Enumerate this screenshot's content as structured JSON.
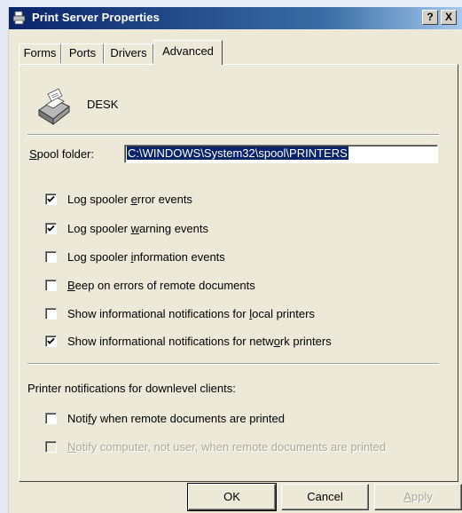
{
  "window": {
    "title": "Print Server Properties",
    "help_label": "?",
    "close_label": "X"
  },
  "tabs": [
    {
      "label": "Forms"
    },
    {
      "label": "Ports"
    },
    {
      "label": "Drivers"
    },
    {
      "label": "Advanced",
      "active": true
    }
  ],
  "server": {
    "name": "DESK"
  },
  "spool": {
    "label": "Spool folder:",
    "value": "C:\\WINDOWS\\System32\\spool\\PRINTERS"
  },
  "options": [
    {
      "label": "Log spooler error events",
      "checked": true
    },
    {
      "label": "Log spooler warning events",
      "checked": true
    },
    {
      "label": "Log spooler information events",
      "checked": false
    },
    {
      "label": "Beep on errors of remote documents",
      "checked": false
    },
    {
      "label": "Show informational notifications for local printers",
      "checked": false
    },
    {
      "label": "Show informational notifications for network printers",
      "checked": true
    }
  ],
  "downlevel": {
    "heading": "Printer notifications for downlevel clients:",
    "options": [
      {
        "label": "Notify when remote documents are printed",
        "checked": false,
        "enabled": true
      },
      {
        "label": "Notify computer, not user, when remote documents are printed",
        "checked": false,
        "enabled": false
      }
    ]
  },
  "buttons": {
    "ok": "OK",
    "cancel": "Cancel",
    "apply": "Apply"
  }
}
